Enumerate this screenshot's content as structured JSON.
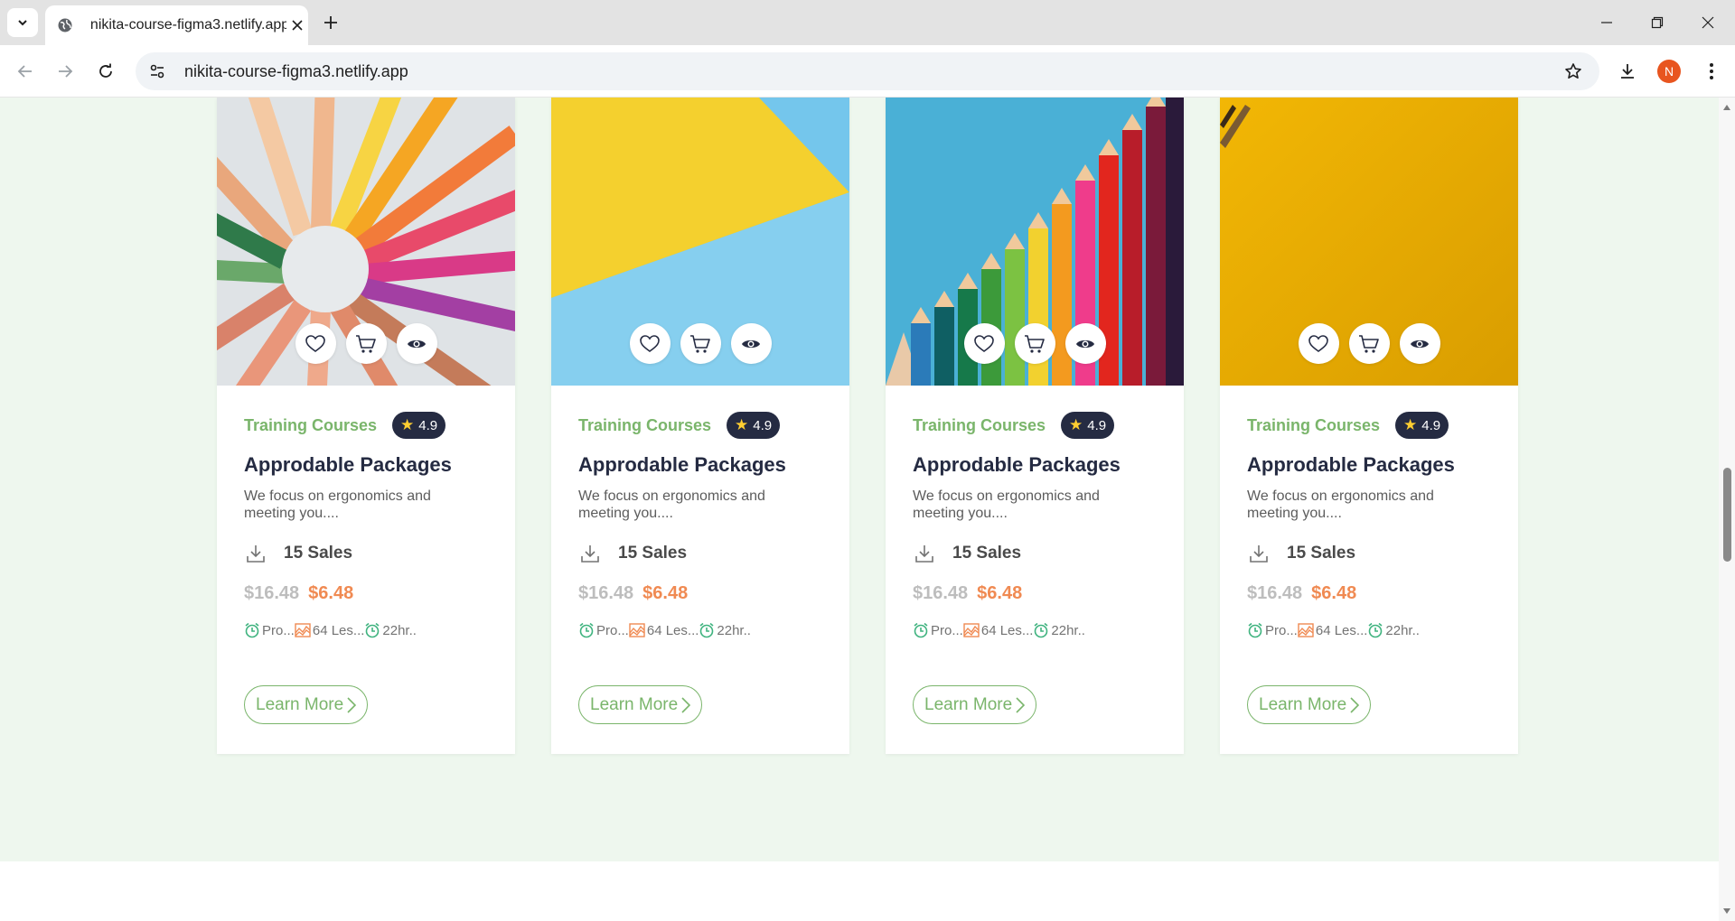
{
  "browser": {
    "tab_title": "nikita-course-figma3.netlify.app",
    "url": "nikita-course-figma3.netlify.app",
    "profile_initial": "N"
  },
  "colors": {
    "section_bg": "#eef7ee",
    "accent_green": "#7ab56b",
    "price_orange": "#f08a52",
    "rating_bg": "#252b42"
  },
  "cards": [
    {
      "image": "colored-pencils-circle",
      "category": "Training Courses",
      "rating": "4.9",
      "title": "Approdable Packages",
      "description": "We focus on ergonomics and meeting you....",
      "sales": "15 Sales",
      "old_price": "$16.48",
      "new_price": "$6.48",
      "stat_1": "Pro...",
      "stat_2": "64 Les...",
      "stat_3": "22hr..",
      "button": "Learn More"
    },
    {
      "image": "yellow-blue-triangle",
      "category": "Training Courses",
      "rating": "4.9",
      "title": "Approdable Packages",
      "description": "We focus on ergonomics and meeting you....",
      "sales": "15 Sales",
      "old_price": "$16.48",
      "new_price": "$6.48",
      "stat_1": "Pro...",
      "stat_2": "64 Les...",
      "stat_3": "22hr..",
      "button": "Learn More"
    },
    {
      "image": "colored-pencils-stairs",
      "category": "Training Courses",
      "rating": "4.9",
      "title": "Approdable Packages",
      "description": "We focus on ergonomics and meeting you....",
      "sales": "15 Sales",
      "old_price": "$16.48",
      "new_price": "$6.48",
      "stat_1": "Pro...",
      "stat_2": "64 Les...",
      "stat_3": "22hr..",
      "button": "Learn More"
    },
    {
      "image": "yellow-background-pencil",
      "category": "Training Courses",
      "rating": "4.9",
      "title": "Approdable Packages",
      "description": "We focus on ergonomics and meeting you....",
      "sales": "15 Sales",
      "old_price": "$16.48",
      "new_price": "$6.48",
      "stat_1": "Pro...",
      "stat_2": "64 Les...",
      "stat_3": "22hr..",
      "button": "Learn More"
    }
  ]
}
